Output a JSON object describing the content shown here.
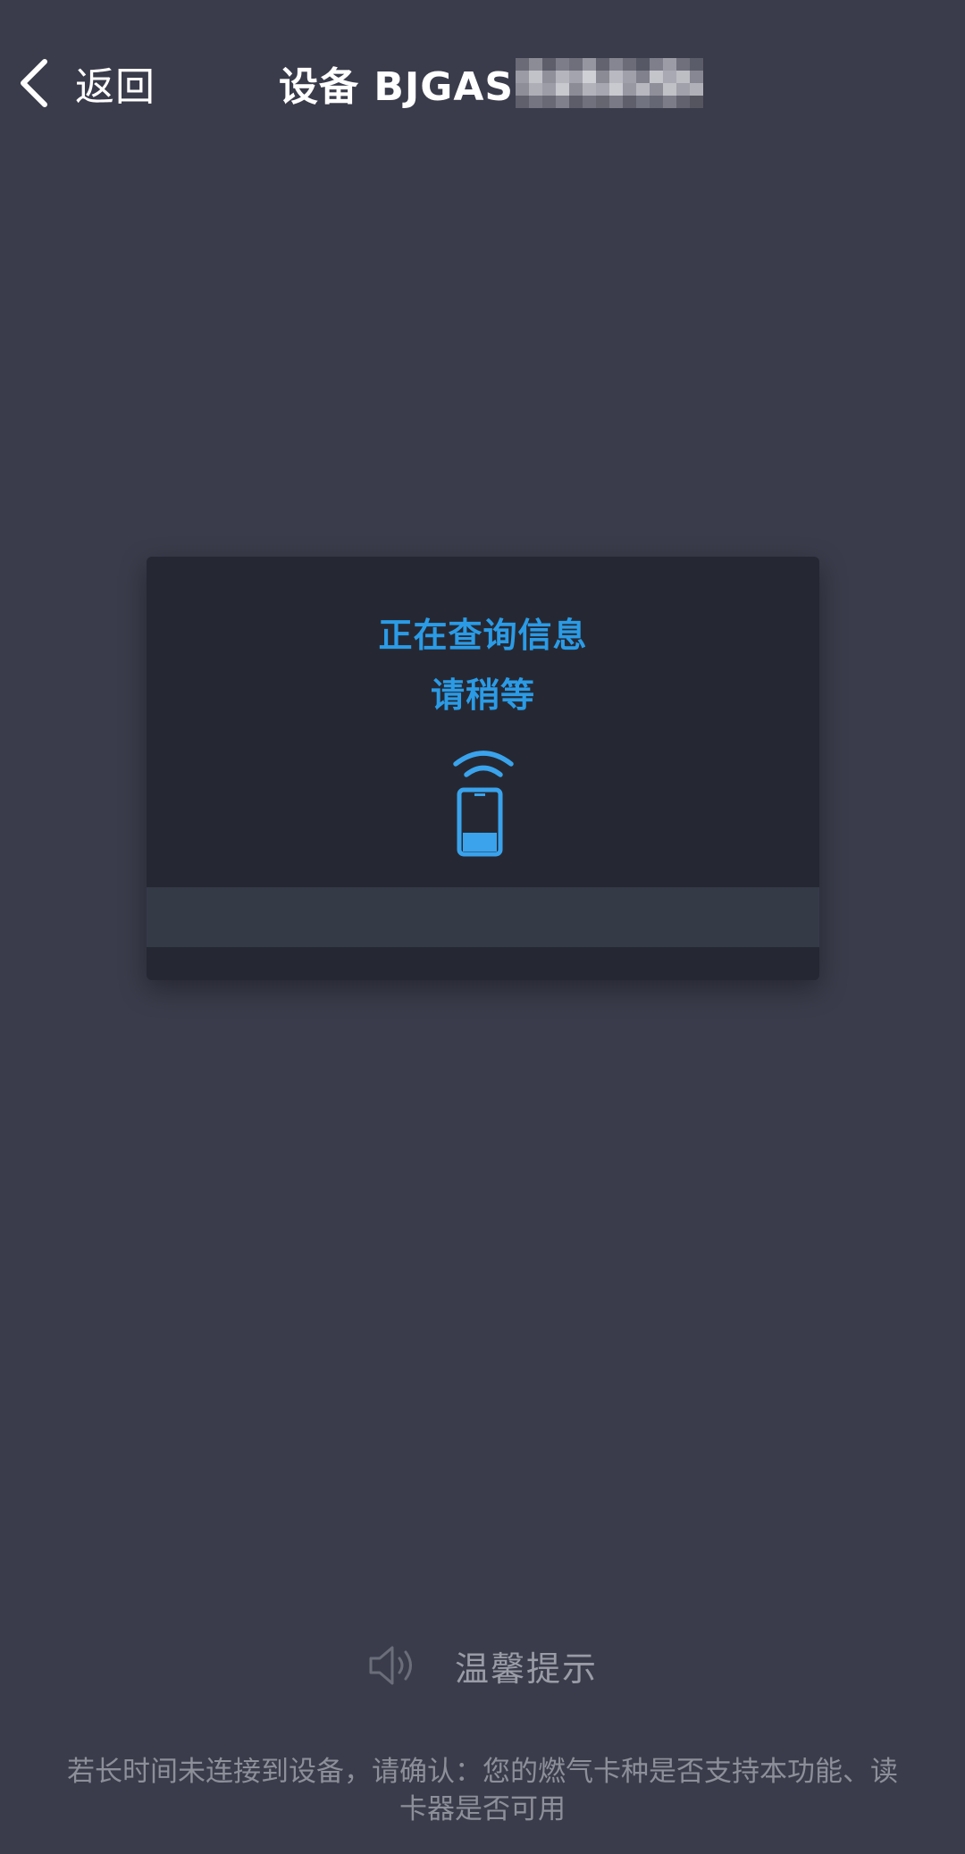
{
  "header": {
    "back_label": "返回",
    "title": "设备 BJGAS"
  },
  "dialog": {
    "line1": "正在查询信息",
    "line2": "请稍等",
    "icon": "nfc-phone-icon"
  },
  "tip": {
    "icon": "speaker-icon",
    "title": "温馨提示",
    "body": "若长时间未连接到设备，请确认：您的燃气卡种是否支持本功能、读卡器是否可用"
  },
  "colors": {
    "background": "#3a3c4b",
    "dialog_bg": "#252833",
    "dialog_footer": "#353a47",
    "accent": "#2b9be6",
    "tip_text": "#8d8f99"
  }
}
